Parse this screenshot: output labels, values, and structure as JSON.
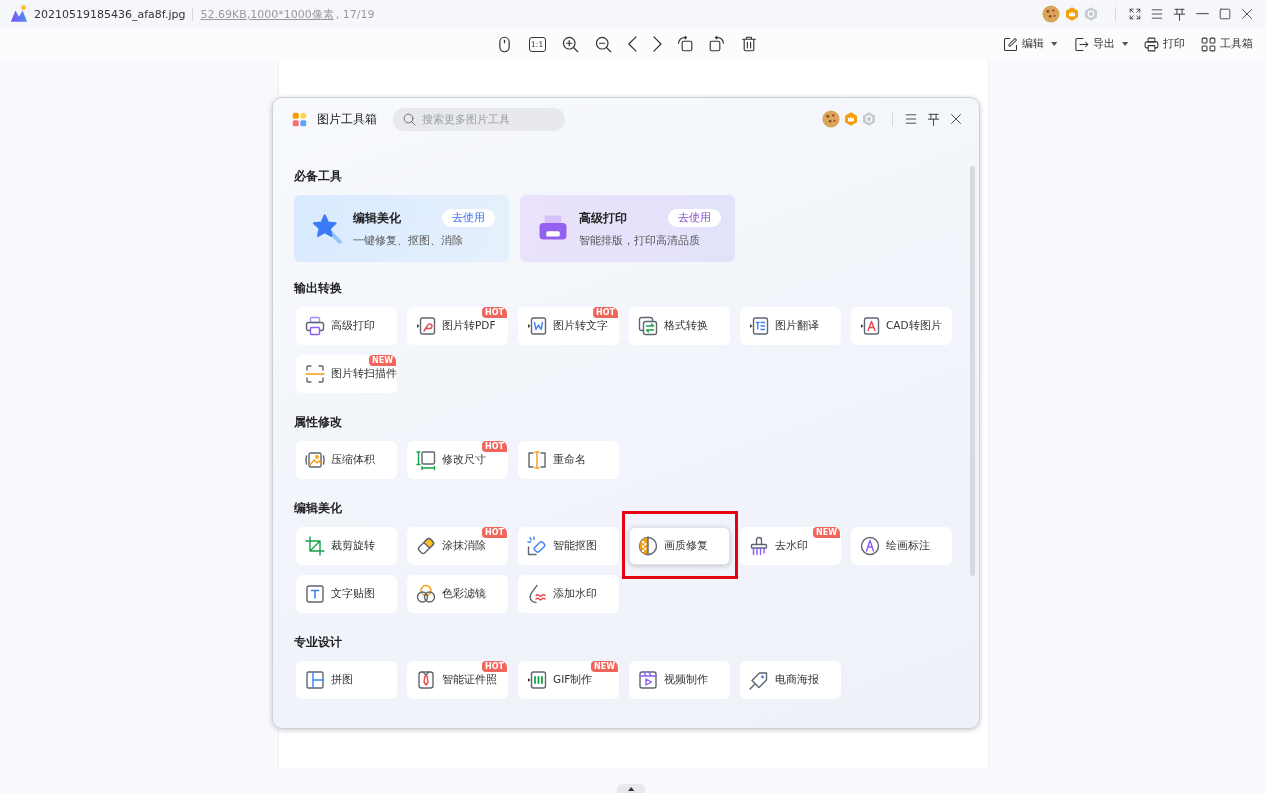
{
  "title_bar": {
    "filename": "20210519185436_afa8f.jpg",
    "file_size": "52.69KB",
    "dimensions": ",1000*1000像素",
    "position": ", 17/19"
  },
  "toolbar": {
    "actual_size": "1:1",
    "menus": [
      {
        "label": "编辑",
        "dropdown": true
      },
      {
        "label": "导出",
        "dropdown": true
      },
      {
        "label": "打印",
        "dropdown": false
      },
      {
        "label": "工具箱",
        "dropdown": false
      }
    ]
  },
  "toolbox": {
    "title": "图片工具箱",
    "search": {
      "placeholder": "搜索更多图片工具"
    },
    "featured": {
      "title": "必备工具",
      "cards": [
        {
          "title": "编辑美化",
          "description": "一键修复、抠图、消除",
          "button": "去使用"
        },
        {
          "title": "高级打印",
          "description": "智能排版，打印高清品质",
          "button": "去使用"
        }
      ]
    },
    "sections": [
      {
        "title": "输出转换",
        "tools": [
          {
            "label": "高级打印",
            "highlighted": false
          },
          {
            "label": "图片转PDF",
            "badge": "HOT",
            "highlighted": false
          },
          {
            "label": "图片转文字",
            "badge": "HOT",
            "highlighted": false
          },
          {
            "label": "格式转换",
            "highlighted": false
          },
          {
            "label": "图片翻译",
            "highlighted": false
          },
          {
            "label": "CAD转图片",
            "highlighted": false
          },
          {
            "label": "图片转扫描件",
            "badge": "NEW",
            "highlighted": false
          }
        ]
      },
      {
        "title": "属性修改",
        "tools": [
          {
            "label": "压缩体积",
            "highlighted": false
          },
          {
            "label": "修改尺寸",
            "badge": "HOT",
            "highlighted": false
          },
          {
            "label": "重命名",
            "highlighted": false
          }
        ]
      },
      {
        "title": "编辑美化",
        "tools": [
          {
            "label": "裁剪旋转",
            "highlighted": false
          },
          {
            "label": "涂抹消除",
            "badge": "HOT",
            "highlighted": false
          },
          {
            "label": "智能抠图",
            "highlighted": false
          },
          {
            "label": "画质修复",
            "highlighted": true
          },
          {
            "label": "去水印",
            "badge": "NEW",
            "highlighted": false
          },
          {
            "label": "绘画标注",
            "highlighted": false
          },
          {
            "label": "文字贴图",
            "highlighted": false
          },
          {
            "label": "色彩滤镜",
            "highlighted": false
          },
          {
            "label": "添加水印",
            "highlighted": false
          }
        ]
      },
      {
        "title": "专业设计",
        "tools": [
          {
            "label": "拼图",
            "highlighted": false
          },
          {
            "label": "智能证件照",
            "badge": "HOT",
            "highlighted": false
          },
          {
            "label": "GIF制作",
            "badge": "NEW",
            "highlighted": false
          },
          {
            "label": "视频制作",
            "highlighted": false
          },
          {
            "label": "电商海报",
            "highlighted": false
          }
        ]
      }
    ]
  }
}
